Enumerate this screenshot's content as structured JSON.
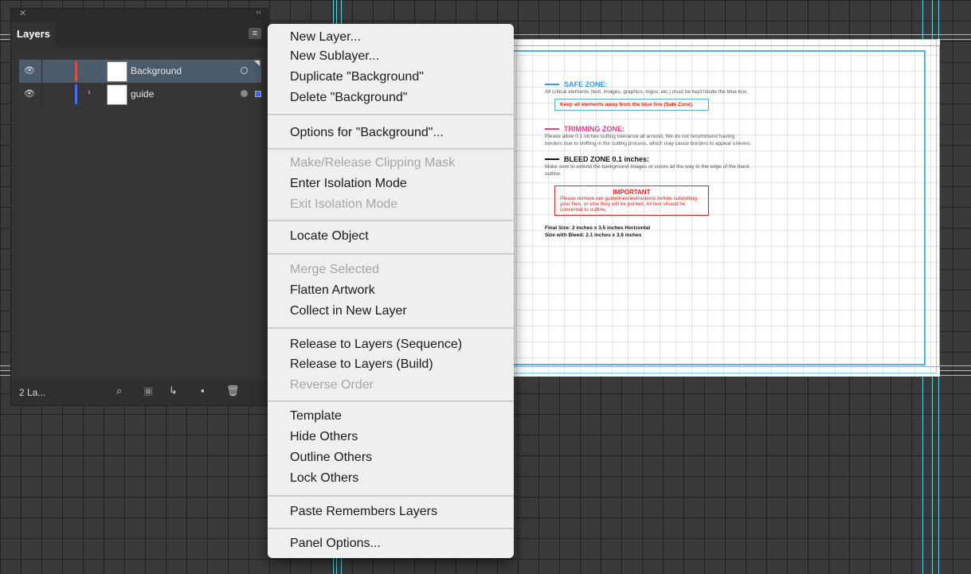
{
  "layers_panel": {
    "close_glyph": "✕",
    "collapse_glyph": "‹‹",
    "tab_label": "Layers",
    "menu_glyph": "≡",
    "layers": [
      {
        "name": "Background",
        "color": "#e34a4a",
        "selected": true
      },
      {
        "name": "guide",
        "color": "#4a6cf0",
        "selected": false,
        "expand_glyph": "›"
      }
    ],
    "eye_glyph": "👁",
    "layer_count": "2 La...",
    "footer_icons": [
      "search-icon",
      "clip-mask-icon",
      "new-sublayer-icon",
      "new-layer-icon",
      "trash-icon"
    ],
    "footer_glyphs": [
      "⌕",
      "▣",
      "↳",
      "▪",
      "🗑"
    ]
  },
  "context_menu": {
    "items": [
      {
        "label": "New Layer...",
        "enabled": true
      },
      {
        "label": "New Sublayer...",
        "enabled": true
      },
      {
        "label": "Duplicate \"Background\"",
        "enabled": true
      },
      {
        "label": "Delete \"Background\"",
        "enabled": true
      },
      {
        "label": "Options for \"Background\"...",
        "enabled": true
      },
      {
        "label": "Make/Release Clipping Mask",
        "enabled": false
      },
      {
        "label": "Enter Isolation Mode",
        "enabled": true
      },
      {
        "label": "Exit Isolation Mode",
        "enabled": false
      },
      {
        "label": "Locate Object",
        "enabled": true
      },
      {
        "label": "Merge Selected",
        "enabled": false
      },
      {
        "label": "Flatten Artwork",
        "enabled": true
      },
      {
        "label": "Collect in New Layer",
        "enabled": true
      },
      {
        "label": "Release to Layers (Sequence)",
        "enabled": true
      },
      {
        "label": "Release to Layers (Build)",
        "enabled": true
      },
      {
        "label": "Reverse Order",
        "enabled": false
      },
      {
        "label": "Template",
        "enabled": true
      },
      {
        "label": "Hide Others",
        "enabled": true
      },
      {
        "label": "Outline Others",
        "enabled": true
      },
      {
        "label": "Lock Others",
        "enabled": true
      },
      {
        "label": "Paste Remembers Layers",
        "enabled": true
      },
      {
        "label": "Panel Options...",
        "enabled": true
      }
    ]
  },
  "artboard": {
    "safe_zone": {
      "title": "SAFE ZONE:",
      "color": "#2f9be0",
      "body": "All critical elements (text, images, graphics, logos, etc.) must be kept inside the blue box.",
      "warning": "Keep all elements away from the blue line (Safe Zone)."
    },
    "trimming_zone": {
      "title": "TRIMMING ZONE:",
      "color": "#e23c8a",
      "body": "Please allow 0.1 inches cutting tolerance all around. We do not recommend having borders due to shifting in the cutting process, which may cause borders to appear uneven."
    },
    "bleed_zone": {
      "title": "BLEED ZONE 0.1 inches:",
      "color": "#111111",
      "body": "Make sure to extend the background images or colors all the way to the edge of the black outline."
    },
    "important": {
      "title": "IMPORTANT",
      "body": "Please remove our guidelines/instructions before submitting your files, or else they will be printed. All text should be converted to outline."
    },
    "final_size": "Final Size: 2 inches x 3.5 inches Horizontal",
    "bleed_size": "Size with Bleed: 2.1 inches x 3.6 inches"
  }
}
